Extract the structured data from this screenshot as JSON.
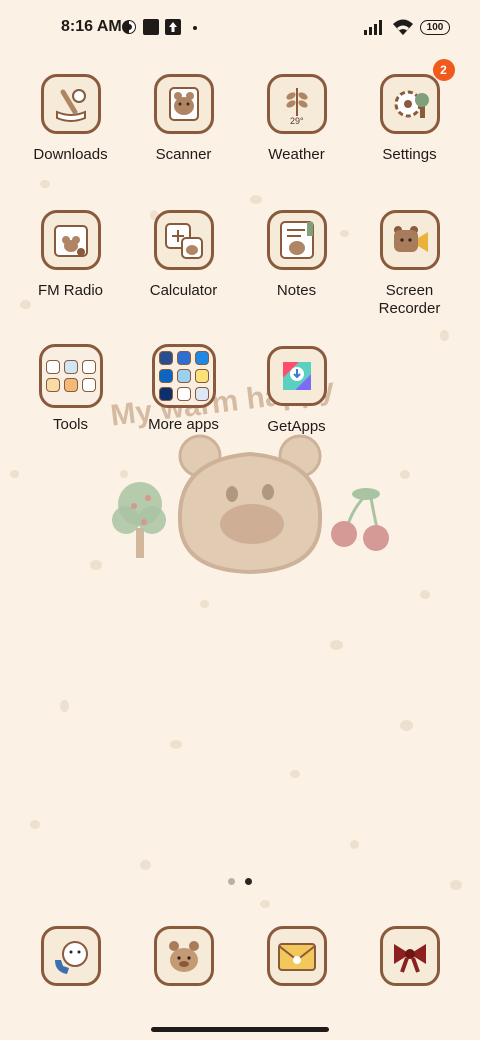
{
  "status_bar": {
    "time": "8:16 AM",
    "battery": "100"
  },
  "apps": [
    {
      "label": "Downloads",
      "icon": "downloads-icon"
    },
    {
      "label": "Scanner",
      "icon": "scanner-icon"
    },
    {
      "label": "Weather",
      "icon": "weather-icon",
      "icon_text": "29°"
    },
    {
      "label": "Settings",
      "icon": "settings-icon",
      "badge": "2"
    },
    {
      "label": "FM Radio",
      "icon": "fm-radio-icon"
    },
    {
      "label": "Calculator",
      "icon": "calculator-icon"
    },
    {
      "label": "Notes",
      "icon": "notes-icon"
    },
    {
      "label": "Screen\nRecorder",
      "icon": "screen-recorder-icon"
    },
    {
      "label": "Tools",
      "icon": "tools-folder-icon"
    },
    {
      "label": "More apps",
      "icon": "more-apps-folder-icon"
    },
    {
      "label": "GetApps",
      "icon": "getapps-icon"
    }
  ],
  "wallpaper_text": "My warm happy",
  "page_indicator": {
    "pages": 2,
    "active": 2
  },
  "dock": [
    {
      "icon": "phone-icon"
    },
    {
      "icon": "messages-icon"
    },
    {
      "icon": "mail-icon"
    },
    {
      "icon": "camera-bow-icon"
    }
  ],
  "colors": {
    "background": "#fbf1e5",
    "icon_border": "#8a5a3c",
    "badge": "#f05a1c"
  }
}
